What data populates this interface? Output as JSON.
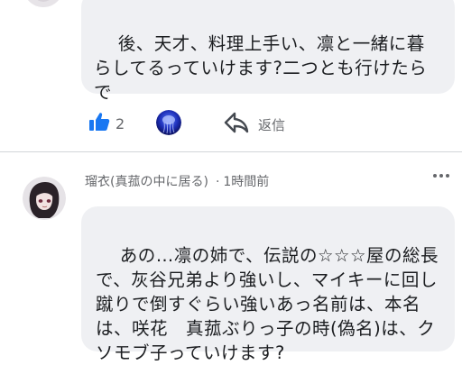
{
  "comment1": {
    "text": "後、天才、料理上手い、凛と一緒に暮らしてるっていけます?二つとも行けたらで",
    "like_count": "2",
    "reply_label": "返信"
  },
  "comment2": {
    "author": "瑠衣(真菰の中に居る)",
    "time": "1時間前",
    "text": "あの…凛の姉で、伝説の☆☆☆屋の総長で、灰谷兄弟より強いし、マイキーに回し蹴りで倒すぐらい強いあっ名前は、本名は、咲花　真菰ぶりっ子の時(偽名)は、クソモブ子っていけます?"
  },
  "colors": {
    "like_blue": "#1877f2",
    "secondary_text": "#65676b",
    "bubble_bg": "#eff0f3"
  },
  "icons": {
    "like": "thumbs-up-icon",
    "reply": "reply-arrow-icon",
    "more": "more-options-icon"
  }
}
